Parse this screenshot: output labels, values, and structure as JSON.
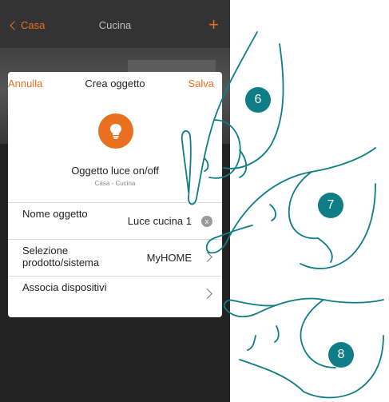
{
  "header": {
    "back_label": "Casa",
    "title": "Cucina",
    "add_label": "+"
  },
  "dialog": {
    "cancel_label": "Annulla",
    "title": "Crea oggetto",
    "save_label": "Salva",
    "object_name": "Oggetto luce on/off",
    "object_location": "Casa - Cucina",
    "rows": [
      {
        "label": "Nome oggetto",
        "value": "Luce cucina 1"
      },
      {
        "label": "Selezione prodotto/sistema",
        "value": "MyHOME"
      },
      {
        "label": "Associa dispositivi",
        "value": ""
      }
    ],
    "clear_icon": "x"
  },
  "steps": [
    "6",
    "7",
    "8"
  ],
  "colors": {
    "accent": "#e8701e",
    "badge": "#0e7d85",
    "bar": "#333333"
  }
}
